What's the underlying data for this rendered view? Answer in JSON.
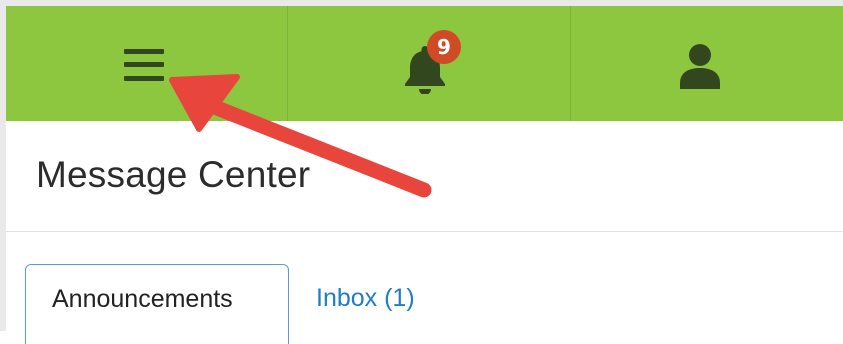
{
  "topbar": {
    "background_color": "#8dc63f",
    "menu_icon": "hamburger-menu-icon",
    "notifications": {
      "icon": "bell-icon",
      "badge_count": "9",
      "badge_color": "#d04a25"
    },
    "profile_icon": "user-icon"
  },
  "page": {
    "title": "Message Center"
  },
  "tabs": [
    {
      "label": "Announcements",
      "active": true
    },
    {
      "label": "Inbox (1)",
      "active": false
    }
  ],
  "annotation": {
    "arrow_color": "#e8453c",
    "points_to": "hamburger-menu-icon"
  },
  "colors": {
    "tab_link": "#1f7ec6",
    "tab_active_border": "#5a9bd5"
  }
}
